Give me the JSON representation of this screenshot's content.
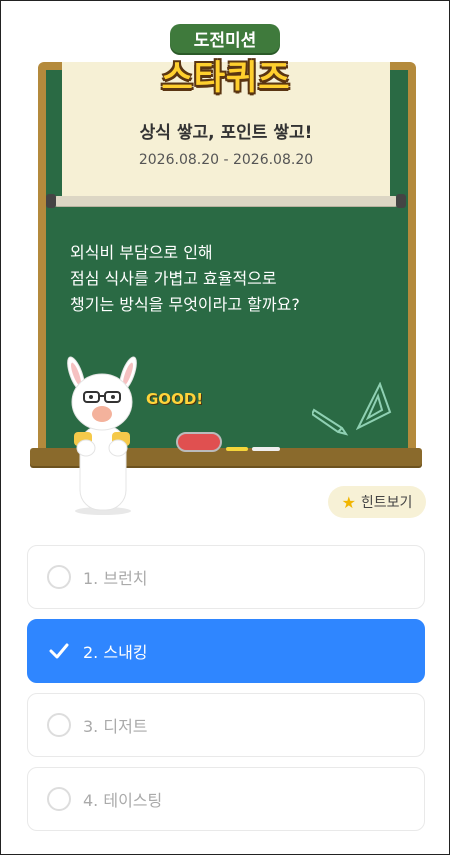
{
  "logo": {
    "sub_title": "도전미션",
    "main_title": "스타퀴즈"
  },
  "paper": {
    "title": "상식 쌓고, 포인트 쌓고!",
    "date_range": "2026.08.20 - 2026.08.20"
  },
  "question": "외식비 부담으로 인해\n점심 식사를 가볍고 효율적으로\n챙기는 방식을 무엇이라고 할까요?",
  "decoration": {
    "good_text": "GOOD!"
  },
  "hint": {
    "label": "힌트보기",
    "icon": "star-icon"
  },
  "options": [
    {
      "label": "1. 브런치",
      "selected": false
    },
    {
      "label": "2. 스내킹",
      "selected": true
    },
    {
      "label": "3. 디저트",
      "selected": false
    },
    {
      "label": "4. 테이스팅",
      "selected": false
    }
  ],
  "colors": {
    "board": "#2a6a44",
    "selected": "#2f86ff",
    "hint_bg": "#f7f1d6"
  }
}
